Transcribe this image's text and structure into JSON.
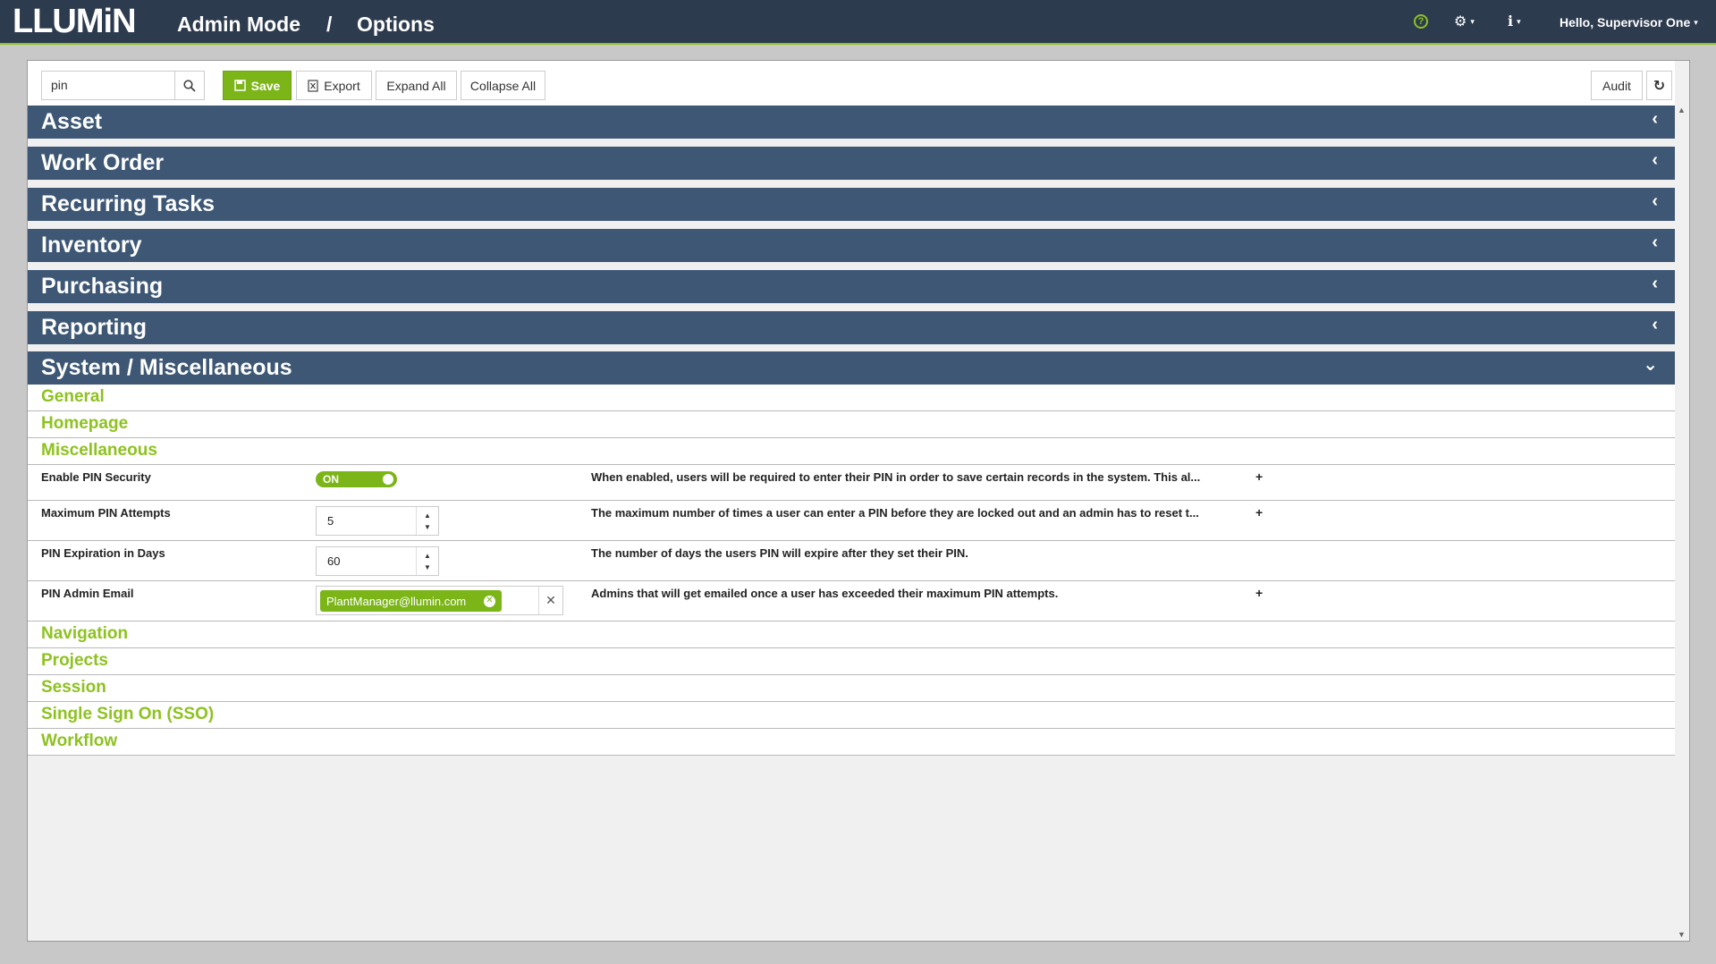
{
  "app": {
    "logo": "LLUMiN",
    "breadcrumb": [
      "Admin Mode",
      "/",
      "Options"
    ],
    "user_greeting": "Hello, Supervisor One",
    "accent_color": "#8dc21f",
    "nav_color": "#2d3b4f"
  },
  "icons": {
    "help": "?",
    "gear": "⚙",
    "info": "ℹ",
    "caret": "▾",
    "search": "search-icon",
    "collapsed_chevron": "‹",
    "expanded_chevron": "⌄",
    "refresh": "↻"
  },
  "toolbar": {
    "search_value": "pin",
    "save_label": "Save",
    "export_label": "Export",
    "expand_label": "Expand All",
    "collapse_label": "Collapse All",
    "audit_label": "Audit"
  },
  "sections": [
    {
      "title": "Asset",
      "expanded": false
    },
    {
      "title": "Work Order",
      "expanded": false
    },
    {
      "title": "Recurring Tasks",
      "expanded": false
    },
    {
      "title": "Inventory",
      "expanded": false
    },
    {
      "title": "Purchasing",
      "expanded": false
    },
    {
      "title": "Reporting",
      "expanded": false
    },
    {
      "title": "System / Miscellaneous",
      "expanded": true
    }
  ],
  "subsections_before": [
    "General",
    "Homepage",
    "Miscellaneous"
  ],
  "options": [
    {
      "label": "Enable PIN Security",
      "control": "toggle",
      "value": "ON",
      "description": "When enabled, users will be required to enter their PIN in order to save certain records in the system. This al...",
      "expandable": "+"
    },
    {
      "label": "Maximum PIN Attempts",
      "control": "number",
      "value": "5",
      "description": "The maximum number of times a user can enter a PIN before they are locked out and an admin has to reset t...",
      "expandable": "+"
    },
    {
      "label": "PIN Expiration in Days",
      "control": "number",
      "value": "60",
      "description": "The number of days the users PIN will expire after they set their PIN.",
      "expandable": ""
    },
    {
      "label": "PIN Admin Email",
      "control": "tags",
      "value": "PlantManager@llumin.com",
      "description": "Admins that will get emailed once a user has exceeded their maximum PIN attempts.",
      "expandable": "+"
    }
  ],
  "subsections_after": [
    "Navigation",
    "Projects",
    "Session",
    "Single Sign On (SSO)",
    "Workflow"
  ]
}
